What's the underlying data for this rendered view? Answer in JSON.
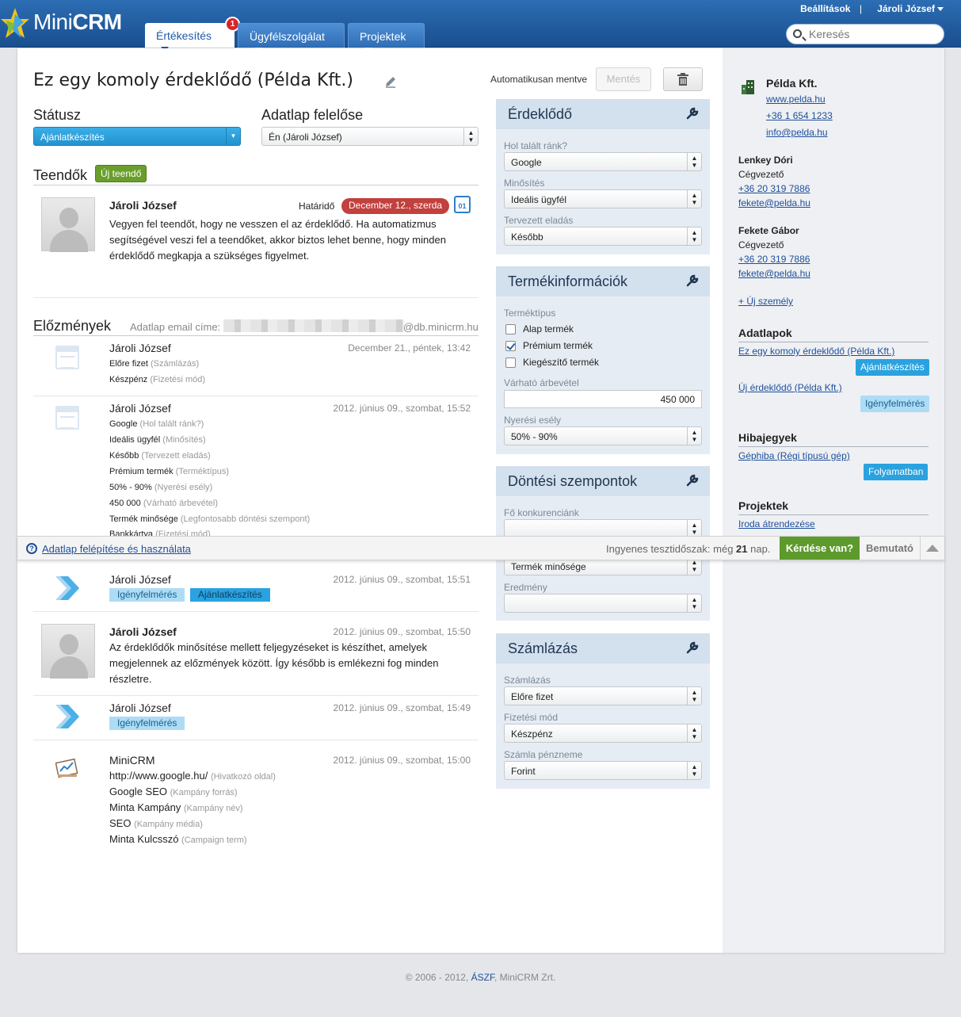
{
  "header": {
    "brand_a": "Mini",
    "brand_b": "CRM",
    "tabs": [
      {
        "label": "Értékesítés"
      },
      {
        "label": "Ügyfélszolgálat"
      },
      {
        "label": "Projektek"
      }
    ],
    "notification_count": "1",
    "settings_label": "Beállítások",
    "separator": "|",
    "user_name": "Jároli József",
    "search_placeholder": "Keresés"
  },
  "record": {
    "title": "Ez egy komoly érdeklődő (Példa Kft.)",
    "autosave_text": "Automatikusan mentve",
    "save_label": "Mentés",
    "status_label": "Státusz",
    "status_value": "Ajánlatkészítés",
    "owner_label": "Adatlap felelőse",
    "owner_value": "Én (Jároli József)"
  },
  "todos": {
    "title": "Teendők",
    "new_label": "Új teendő",
    "item": {
      "author": "Jároli József",
      "deadline_label": "Határidő",
      "deadline_value": "December 12., szerda",
      "calendar_day": "01",
      "text": "Vegyen fel teendőt, hogy ne vesszen el az érdeklődő. Ha automatizmus segítségével veszi fel a teendőket, akkor biztos lehet benne, hogy minden érdeklődő megkapja a szükséges figyelmet."
    }
  },
  "history": {
    "title": "Előzmények",
    "email_label": "Adatlap email címe:",
    "email_domain": "@db.minicrm.hu",
    "entries": [
      {
        "author": "Jároli József",
        "date": "December 21., péntek, 13:42",
        "lines": [
          {
            "value": "Előre fizet",
            "field": "(Számlázás)"
          },
          {
            "value": "Készpénz",
            "field": "(Fizetési mód)"
          }
        ]
      },
      {
        "author": "Jároli József",
        "date": "2012. június 09., szombat, 15:52",
        "lines": [
          {
            "value": "Google",
            "field": "(Hol talált ránk?)"
          },
          {
            "value": "Ideális ügyfél",
            "field": "(Minősítés)"
          },
          {
            "value": "Később",
            "field": "(Tervezett eladás)"
          },
          {
            "value": "Prémium termék",
            "field": "(Terméktípus)"
          },
          {
            "value": "50% - 90%",
            "field": "(Nyerési esély)"
          },
          {
            "value": "450 000",
            "field": "(Várható árbevétel)"
          },
          {
            "value": "Termék minősége",
            "field": "(Legfontosabb döntési szempont)"
          },
          {
            "value": "Bankkártya",
            "field": "(Fizetési mód)"
          }
        ]
      },
      {
        "author": "Jároli József",
        "date": "2012. június 09., szombat, 15:51",
        "tag_from": "Igényfelmérés",
        "tag_to": "Ajánlatkészítés"
      },
      {
        "author": "Jároli József",
        "date": "2012. június 09., szombat, 15:50",
        "text": "Az érdeklődők minősítése mellett feljegyzéseket is készíthet, amelyek megjelennek az előzmények között. Így később is emlékezni fog minden részletre."
      },
      {
        "author": "Jároli József",
        "date": "2012. június 09., szombat, 15:49",
        "tag": "Igényfelmérés"
      },
      {
        "author": "MiniCRM",
        "date": "2012. június 09., szombat, 15:00",
        "lines": [
          {
            "value": "http://www.google.hu/",
            "field": "(Hivatkozó oldal)"
          },
          {
            "value": "Google SEO",
            "field": "(Kampány forrás)"
          },
          {
            "value": "Minta Kampány",
            "field": "(Kampány név)"
          },
          {
            "value": "SEO",
            "field": "(Kampány média)"
          },
          {
            "value": "Minta Kulcsszó",
            "field": "(Campaign term)"
          }
        ]
      }
    ]
  },
  "panels": {
    "lead": {
      "title": "Érdeklődő",
      "fields": [
        {
          "label": "Hol talált ránk?",
          "value": "Google"
        },
        {
          "label": "Minősítés",
          "value": "Ideális ügyfél"
        },
        {
          "label": "Tervezett eladás",
          "value": "Később"
        }
      ]
    },
    "product": {
      "title": "Termékinformációk",
      "type_label": "Terméktípus",
      "options": [
        {
          "label": "Alap termék",
          "checked": false
        },
        {
          "label": "Prémium termék",
          "checked": true
        },
        {
          "label": "Kiegészítő termék",
          "checked": false
        }
      ],
      "revenue_label": "Várható árbevétel",
      "revenue_value": "450 000",
      "chance_label": "Nyerési esély",
      "chance_value": "50% - 90%"
    },
    "decision": {
      "title": "Döntési szempontok",
      "competitor_label": "Fő konkurenciánk",
      "competitor_value": "",
      "main_value": "Termék minősége",
      "result_label": "Eredmény",
      "result_value": ""
    },
    "billing": {
      "title": "Számlázás",
      "fields": [
        {
          "label": "Számlázás",
          "value": "Előre fizet"
        },
        {
          "label": "Fizetési mód",
          "value": "Készpénz"
        },
        {
          "label": "Számla pénzneme",
          "value": "Forint"
        }
      ]
    }
  },
  "sidebar": {
    "company": {
      "name": "Példa Kft.",
      "web": "www.pelda.hu",
      "phone": "+36 1 654 1233",
      "email": "info@pelda.hu"
    },
    "persons": [
      {
        "name": "Lenkey Dóri",
        "role": "Cégvezető",
        "phone": "+36 20 319 7886",
        "email": "fekete@pelda.hu"
      },
      {
        "name": "Fekete Gábor",
        "role": "Cégvezető",
        "phone": "+36 20 319 7886",
        "email": "fekete@pelda.hu"
      }
    ],
    "new_person": "+ Új személy",
    "sheets_title": "Adatlapok",
    "sheets": [
      {
        "name": "Ez egy komoly érdeklődő (Példa Kft.)",
        "status": "Ajánlatkészítés"
      },
      {
        "name": "Új érdeklődő (Példa Kft.)",
        "status": "Igényfelmérés"
      }
    ],
    "tickets_title": "Hibajegyek",
    "tickets": [
      {
        "name": "Géphiba (Régi típusú gép)",
        "status": "Folyamatban"
      }
    ],
    "projects_title": "Projektek",
    "projects": [
      {
        "name": "Iroda átrendezése"
      }
    ]
  },
  "helpbar": {
    "help_link": "Adatlap felépítése és használata",
    "trial_prefix": "Ingyenes tesztidőszak: még",
    "trial_days": "21",
    "trial_suffix": "nap.",
    "question_label": "Kérdése van?",
    "demo_label": "Bemutató"
  },
  "footer": {
    "prefix": "© 2006 - 2012,",
    "terms": "ÁSZF",
    "suffix": ", MiniCRM Zrt."
  },
  "colors": {
    "topbar": "#1f5a9e",
    "status_blue": "#2aa2df",
    "green": "#6a9e2b",
    "deadline_red": "#c2403d"
  }
}
